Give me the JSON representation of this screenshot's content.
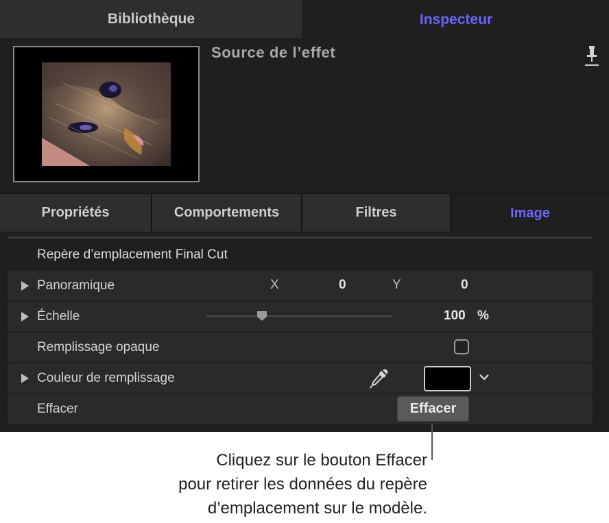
{
  "tabs": {
    "library": "Bibliothèque",
    "inspector": "Inspecteur"
  },
  "header": {
    "title": "Source de l’effet",
    "pin_icon": "pushpin-icon"
  },
  "section_tabs": [
    "Propriétés",
    "Comportements",
    "Filtres",
    "Image"
  ],
  "colors": {
    "accent": "#6a64ff",
    "panel_bg": "#1f1f1f",
    "row_bg": "#2a2a2a"
  },
  "group": {
    "title": "Repère d’emplacement Final Cut",
    "rows": {
      "pan": {
        "label": "Panoramique",
        "x_label": "X",
        "x_value": "0",
        "y_label": "Y",
        "y_value": "0"
      },
      "scale": {
        "label": "Échelle",
        "value": "100",
        "unit": "%",
        "slider_fraction": 0.3
      },
      "opaque_fill": {
        "label": "Remplissage opaque",
        "checked": false
      },
      "fill_color": {
        "label": "Couleur de remplissage",
        "swatch_color": "#000000"
      },
      "clear": {
        "label": "Effacer",
        "button_label": "Effacer"
      }
    }
  },
  "callout": {
    "line1": "Cliquez sur le bouton Effacer",
    "line2": "pour retirer les données du repère",
    "line3": "d’emplacement sur le modèle."
  }
}
